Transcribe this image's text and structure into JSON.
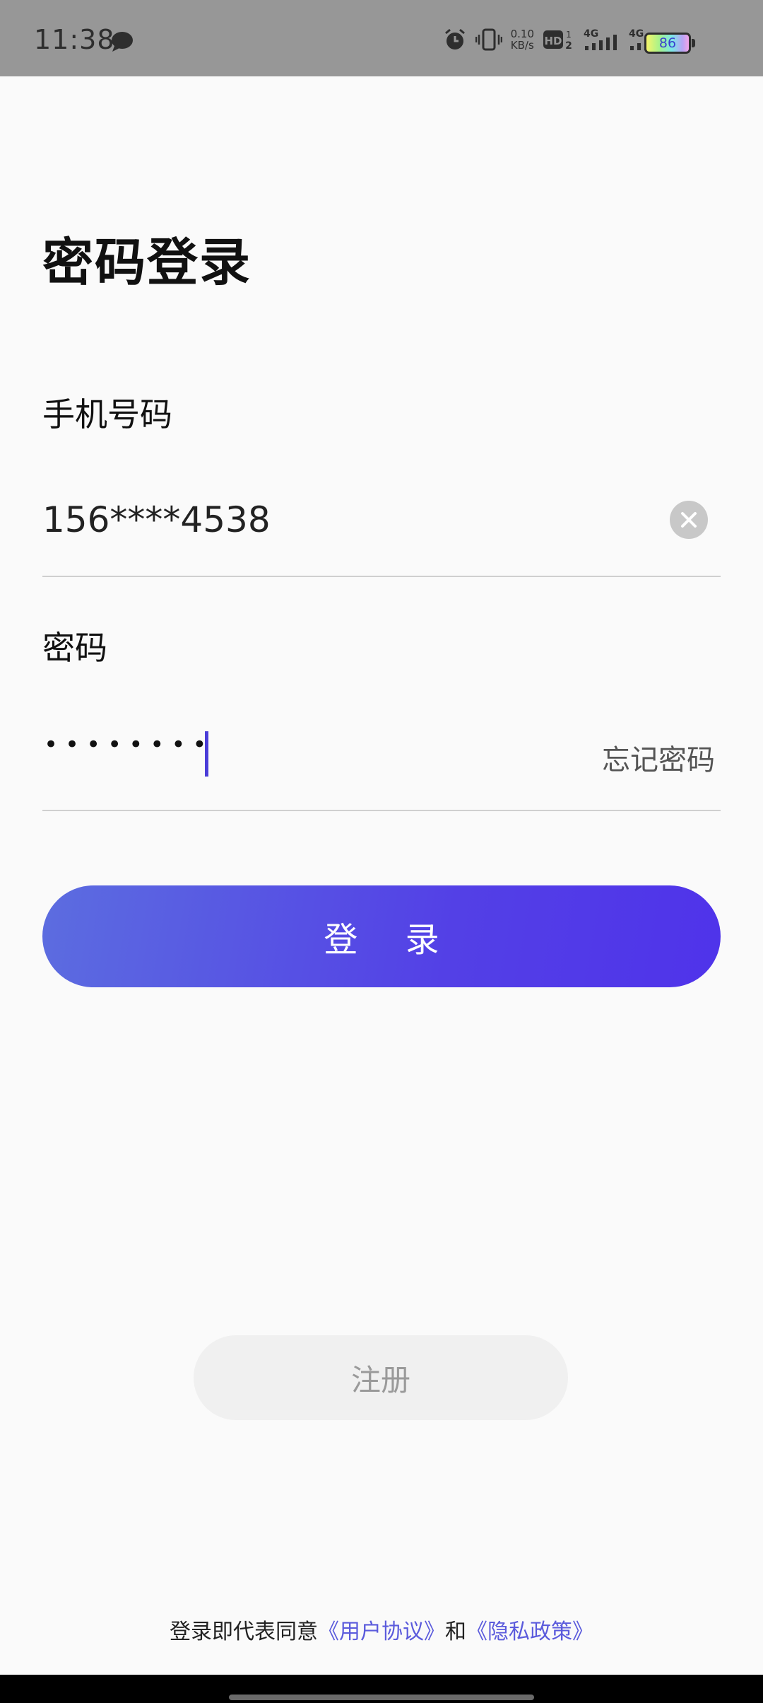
{
  "status_bar": {
    "time": "11:38",
    "net_speed_value": "0.10",
    "net_speed_unit": "KB/s",
    "hd_label": "HD",
    "sim1_label": "4G",
    "sim2_label": "4G",
    "battery_level": "86",
    "icons": [
      "chat-icon",
      "alarm-icon",
      "vibrate-icon",
      "hd-icon",
      "signal-icon",
      "signal-icon",
      "battery-icon"
    ]
  },
  "page": {
    "title": "密码登录"
  },
  "form": {
    "phone_label": "手机号码",
    "phone_value": "156****4538",
    "password_label": "密码",
    "password_masked": "••••••••",
    "forgot_password": "忘记密码"
  },
  "actions": {
    "login_label": "登 录",
    "register_label": "注册"
  },
  "agreement": {
    "prefix": "登录即代表同意",
    "user_agreement": "《用户协议》",
    "conjunction": "和",
    "privacy_policy": "《隐私政策》"
  },
  "colors": {
    "accent_start": "#5c6de0",
    "accent_end": "#4f33ea",
    "link": "#5b5bdc",
    "status_bar_bg": "#979797",
    "page_bg": "#fafafa"
  }
}
